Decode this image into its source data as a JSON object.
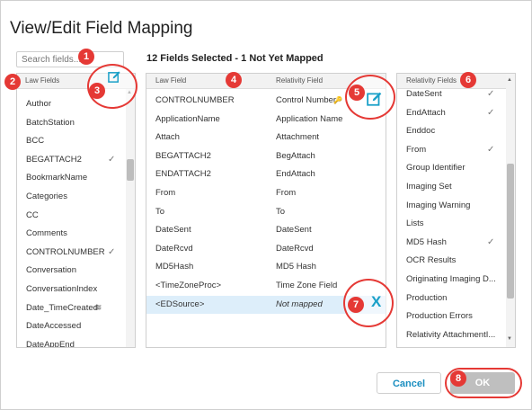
{
  "dialog": {
    "title": "View/Edit Field Mapping",
    "search_placeholder": "Search fields...",
    "summary": "12 Fields Selected - 1 Not Yet Mapped"
  },
  "left_panel": {
    "header": "Law Fields",
    "items": [
      {
        "label": "Author",
        "checked": false
      },
      {
        "label": "BatchStation",
        "checked": false
      },
      {
        "label": "BCC",
        "checked": false
      },
      {
        "label": "BEGATTACH2",
        "checked": true
      },
      {
        "label": "BookmarkName",
        "checked": false
      },
      {
        "label": "Categories",
        "checked": false
      },
      {
        "label": "CC",
        "checked": false
      },
      {
        "label": "Comments",
        "checked": false
      },
      {
        "label": "CONTROLNUMBER",
        "checked": true
      },
      {
        "label": "Conversation",
        "checked": false
      },
      {
        "label": "ConversationIndex",
        "checked": false
      },
      {
        "label": "Date_TimeCreated",
        "checked": false,
        "icon": "stack-icon"
      },
      {
        "label": "DateAccessed",
        "checked": false
      },
      {
        "label": "DateAppEnd",
        "checked": false
      }
    ]
  },
  "middle_panel": {
    "header_left": "Law Field",
    "header_right": "Relativity Field",
    "rows": [
      {
        "law": "CONTROLNUMBER",
        "rel": "Control Number",
        "key": true
      },
      {
        "law": "ApplicationName",
        "rel": "Application Name"
      },
      {
        "law": "Attach",
        "rel": "Attachment"
      },
      {
        "law": "BEGATTACH2",
        "rel": "BegAttach"
      },
      {
        "law": "ENDATTACH2",
        "rel": "EndAttach"
      },
      {
        "law": "From",
        "rel": "From"
      },
      {
        "law": "To",
        "rel": "To"
      },
      {
        "law": "DateSent",
        "rel": "DateSent"
      },
      {
        "law": "DateRcvd",
        "rel": "DateRcvd"
      },
      {
        "law": "MD5Hash",
        "rel": "MD5 Hash"
      },
      {
        "law": "<TimeZoneProc>",
        "rel": "Time Zone Field"
      },
      {
        "law": "<EDSource>",
        "rel": "Not mapped",
        "selected": true
      }
    ]
  },
  "right_panel": {
    "header": "Relativity Fields",
    "items": [
      {
        "label": "DateSent",
        "checked": true
      },
      {
        "label": "EndAttach",
        "checked": true
      },
      {
        "label": "Enddoc",
        "checked": false
      },
      {
        "label": "From",
        "checked": true
      },
      {
        "label": "Group Identifier",
        "checked": false
      },
      {
        "label": "Imaging Set",
        "checked": false
      },
      {
        "label": "Imaging Warning",
        "checked": false
      },
      {
        "label": "Lists",
        "checked": false
      },
      {
        "label": "MD5 Hash",
        "checked": true
      },
      {
        "label": "OCR Results",
        "checked": false
      },
      {
        "label": "Originating Imaging D...",
        "checked": false
      },
      {
        "label": "Production",
        "checked": false
      },
      {
        "label": "Production Errors",
        "checked": false
      },
      {
        "label": "Relativity AttachmentI...",
        "checked": false
      }
    ]
  },
  "buttons": {
    "cancel": "Cancel",
    "ok": "OK"
  },
  "callouts": [
    "1",
    "2",
    "3",
    "4",
    "5",
    "6",
    "7",
    "8"
  ],
  "glyphs": {
    "check": "✓",
    "remove": "X",
    "up": "▲",
    "down": "▼",
    "key": "🔑",
    "stack": "≋"
  },
  "colors": {
    "accent": "#1aa0c8",
    "callout": "#e53935",
    "selected_row": "#ddeefa"
  }
}
